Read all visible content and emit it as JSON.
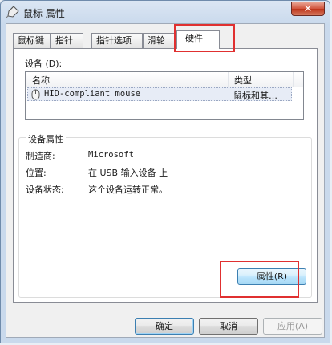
{
  "window": {
    "title": "鼠标 属性",
    "close_glyph": "✕"
  },
  "tabs": [
    {
      "label": "鼠标键",
      "active": false
    },
    {
      "label": "指针",
      "active": false
    },
    {
      "label": "指针选项",
      "active": false
    },
    {
      "label": "滑轮",
      "active": false
    },
    {
      "label": "硬件",
      "active": true
    }
  ],
  "devices": {
    "label": "设备 (D):",
    "columns": [
      "名称",
      "类型"
    ],
    "rows": [
      {
        "name": "HID-compliant mouse",
        "type": "鼠标和其…"
      }
    ]
  },
  "properties": {
    "title": "设备属性",
    "rows": [
      {
        "label": "制造商:",
        "value": "Microsoft"
      },
      {
        "label": "位置:",
        "value": "在 USB 输入设备 上"
      },
      {
        "label": "设备状态:",
        "value": "这个设备运转正常。"
      }
    ],
    "button_label": "属性(R)"
  },
  "footer": {
    "ok": "确定",
    "cancel": "取消",
    "apply": "应用(A)"
  },
  "icons": {
    "title": "mouse-icon",
    "device": "mouse-icon"
  },
  "colors": {
    "highlight": "#e03030",
    "close_button": "#c9482c",
    "selection": "#e7ecf6"
  }
}
